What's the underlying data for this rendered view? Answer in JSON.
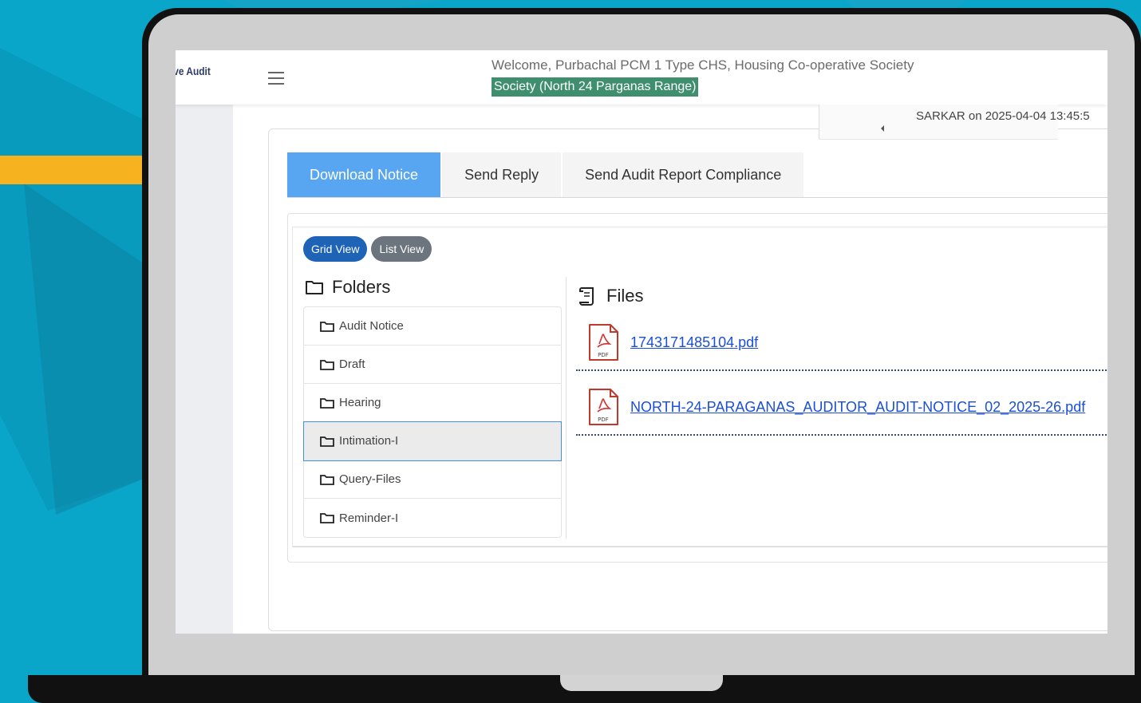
{
  "header": {
    "brand": "ive Audit",
    "welcome": "Welcome,  Purbachal PCM 1 Type CHS,  Housing Co-operative Society",
    "society_tag": "Society (North 24 Parganas Range)"
  },
  "status": {
    "text": "SARKAR on 2025-04-04 13:45:5"
  },
  "tabs": [
    {
      "label": "Download Notice",
      "active": true
    },
    {
      "label": "Send Reply",
      "active": false
    },
    {
      "label": "Send Audit Report Compliance",
      "active": false
    }
  ],
  "view_toggle": {
    "grid_label": "Grid View",
    "list_label": "List View"
  },
  "folders": {
    "title": "Folders",
    "items": [
      {
        "label": "Audit Notice"
      },
      {
        "label": "Draft"
      },
      {
        "label": "Hearing"
      },
      {
        "label": "Intimation-I",
        "selected": true
      },
      {
        "label": "Query-Files"
      },
      {
        "label": "Reminder-I"
      }
    ]
  },
  "files": {
    "title": "Files",
    "items": [
      {
        "name": "1743171485104.pdf",
        "icon": "pdf-file-icon"
      },
      {
        "name": "NORTH-24-PARAGANAS_AUDITOR_AUDIT-NOTICE_02_2025-26.pdf",
        "icon": "pdf-file-icon"
      }
    ]
  },
  "colors": {
    "background": "#0aa6c9",
    "accent_stripe": "#f7b21f",
    "active_tab": "#58a6f2",
    "grid_pill": "#1e63b6",
    "list_pill": "#6c757d",
    "society_tag": "#3f8f6f",
    "link": "#1a4fd6"
  }
}
